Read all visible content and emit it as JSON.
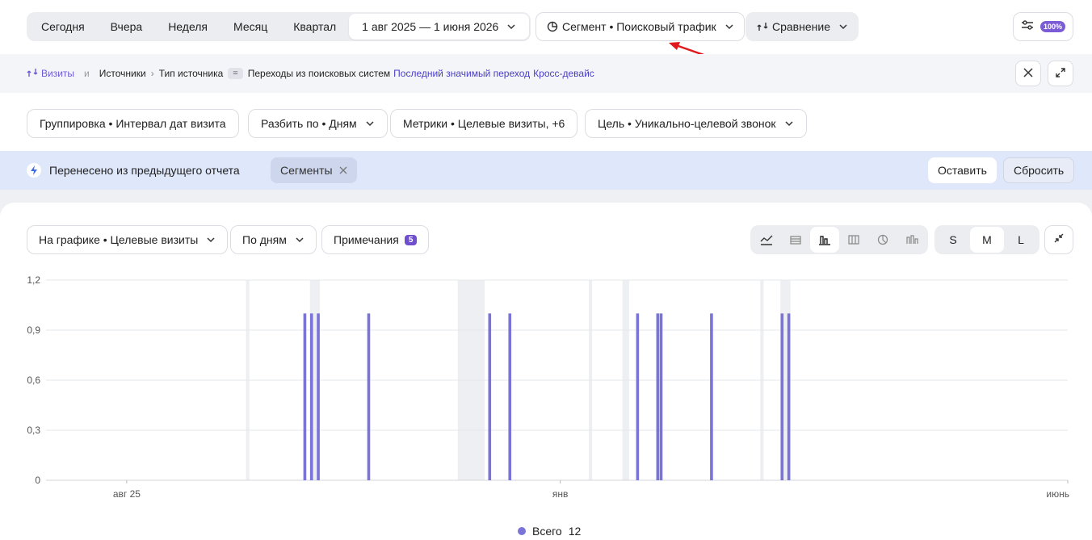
{
  "period": {
    "presets": [
      "Сегодня",
      "Вчера",
      "Неделя",
      "Месяц",
      "Квартал"
    ],
    "range": "1 авг 2025 — 1 июня 2026"
  },
  "segment_label": "Сегмент • Поисковый трафик",
  "compare_label": "Сравнение",
  "sampling_badge": "100%",
  "breadcrumb": {
    "metric": "Визиты",
    "and": "и",
    "dimension": "Источники",
    "filter_field": "Тип источника",
    "operator": "=",
    "filter_value": "Переходы из поисковых систем",
    "attribution": "Последний значимый переход",
    "cross_device": "Кросс-девайс"
  },
  "grouping": {
    "group_by": "Группировка • Интервал дат визита",
    "split_by": "Разбить по • Дням",
    "metrics": "Метрики • Целевые визиты, +6",
    "goal": "Цель • Уникально-целевой звонок"
  },
  "notice": {
    "text": "Перенесено из предыдущего отчета",
    "chip": "Сегменты",
    "keep": "Оставить",
    "reset": "Сбросить"
  },
  "chart_controls": {
    "on_chart": "На графике • Целевые визиты",
    "granularity": "По дням",
    "notes": "Примечания",
    "notes_count": "5",
    "chart_types": [
      "line-chart-icon",
      "stacked-area-icon",
      "bar-chart-icon",
      "table-chart-icon",
      "pie-chart-icon",
      "column-chart-icon"
    ],
    "active_chart_type": "bar-chart-icon",
    "sizes": [
      "S",
      "M",
      "L"
    ],
    "active_size": "M"
  },
  "chart_data": {
    "type": "bar",
    "x_start": "2025-08-01",
    "x_end": "2026-06-01",
    "x_ticks": [
      {
        "date": "2025-08-25",
        "label": "авг 25"
      },
      {
        "date": "2026-01-01",
        "label": "янв"
      },
      {
        "date": "2026-06-01",
        "label": "июнь"
      }
    ],
    "y_ticks": [
      "0",
      "0,3",
      "0,6",
      "0,9",
      "1,2"
    ],
    "ylim": [
      0,
      1.2
    ],
    "grid": true,
    "series": [
      {
        "name": "Всего",
        "color": "#7a73d8",
        "points": [
          {
            "date": "2025-10-17",
            "value": 1
          },
          {
            "date": "2025-10-19",
            "value": 1
          },
          {
            "date": "2025-10-21",
            "value": 1
          },
          {
            "date": "2025-11-05",
            "value": 1
          },
          {
            "date": "2025-12-11",
            "value": 1
          },
          {
            "date": "2025-12-17",
            "value": 1
          },
          {
            "date": "2026-01-24",
            "value": 1
          },
          {
            "date": "2026-01-30",
            "value": 1
          },
          {
            "date": "2026-01-31",
            "value": 1
          },
          {
            "date": "2026-02-15",
            "value": 1
          },
          {
            "date": "2026-03-08",
            "value": 1
          },
          {
            "date": "2026-03-10",
            "value": 1
          }
        ]
      }
    ],
    "highlight_bands": [
      {
        "from": "2025-09-30",
        "to": "2025-09-30"
      },
      {
        "from": "2025-10-19",
        "to": "2025-10-19"
      },
      {
        "from": "2025-10-20",
        "to": "2025-10-21"
      },
      {
        "from": "2025-12-02",
        "to": "2025-12-09"
      },
      {
        "from": "2026-01-10",
        "to": "2026-01-10"
      },
      {
        "from": "2026-01-20",
        "to": "2026-01-21"
      },
      {
        "from": "2026-03-02",
        "to": "2026-03-02"
      },
      {
        "from": "2026-03-08",
        "to": "2026-03-08"
      },
      {
        "from": "2026-03-09",
        "to": "2026-03-10"
      }
    ],
    "legend_position": "bottom-center"
  },
  "legend": {
    "name": "Всего",
    "total": "12"
  }
}
